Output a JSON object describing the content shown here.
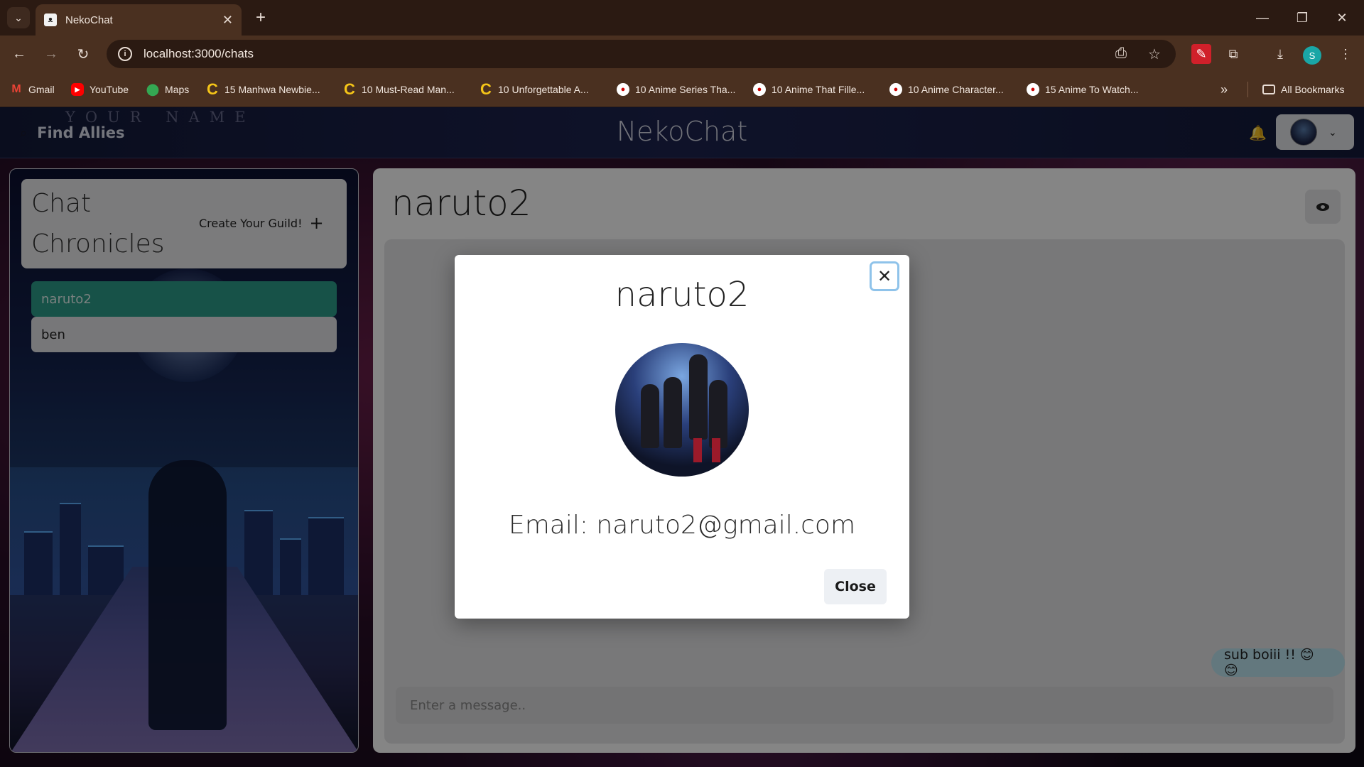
{
  "browser": {
    "tab_title": "NekoChat",
    "tab_favicon": "cat-logo-icon",
    "url": "localhost:3000/chats",
    "bookmarks": [
      {
        "label": "Gmail",
        "icon": "gmail-icon"
      },
      {
        "label": "YouTube",
        "icon": "youtube-icon"
      },
      {
        "label": "Maps",
        "icon": "maps-icon"
      },
      {
        "label": "15 Manhwa Newbie...",
        "icon": "c-logo-icon"
      },
      {
        "label": "10 Must-Read Man...",
        "icon": "c-logo-icon"
      },
      {
        "label": "10 Unforgettable A...",
        "icon": "c-logo-icon"
      },
      {
        "label": "10 Anime Series Tha...",
        "icon": "k-logo-icon"
      },
      {
        "label": "10 Anime That Fille...",
        "icon": "k-logo-icon"
      },
      {
        "label": "10 Anime Character...",
        "icon": "k-logo-icon"
      },
      {
        "label": "15 Anime To Watch...",
        "icon": "k-logo-icon"
      }
    ],
    "all_bookmarks_label": "All Bookmarks",
    "profile_initial": "S"
  },
  "header": {
    "search_label": "Find Allies",
    "overlay_text": "YOUR NAME",
    "brand": "NekoChat"
  },
  "sidebar": {
    "title": "Chat Chronicles",
    "create_label": "Create Your Guild!",
    "chats": [
      {
        "name": "naruto2",
        "active": true
      },
      {
        "name": "ben",
        "active": false
      }
    ]
  },
  "conversation": {
    "title": "naruto2",
    "messages": [
      {
        "text": "sub boiii !! 😊 😊",
        "sender": "self"
      }
    ],
    "input_placeholder": "Enter a message.."
  },
  "modal": {
    "title": "naruto2",
    "email": "Email: naruto2@gmail.com",
    "close_label": "Close"
  },
  "colors": {
    "active_chat": "#2c9e8a",
    "message_bubble": "#bfe6f2",
    "browser_frame": "#4a3020"
  }
}
